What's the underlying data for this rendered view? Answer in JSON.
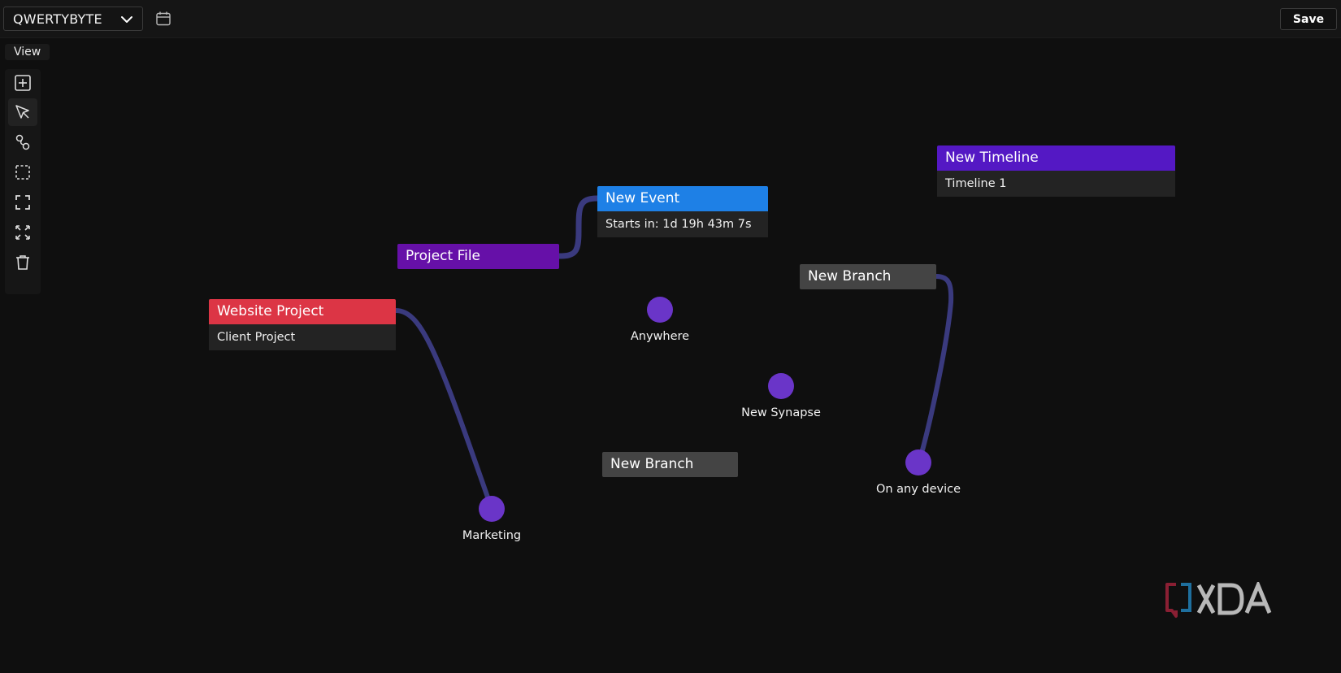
{
  "header": {
    "workspace": "QWERTYBYTE",
    "save_label": "Save"
  },
  "view_tab": "View",
  "toolbar": {
    "tools": [
      "add-icon",
      "select-cursor-icon",
      "link-icon",
      "selection-box-icon",
      "fit-view-icon",
      "expand-icon",
      "trash-icon"
    ]
  },
  "nodes": {
    "website_project": {
      "title": "Website Project",
      "subtitle": "Client Project",
      "color": "#dc3545"
    },
    "project_file": {
      "title": "Project File",
      "color": "#6610a8"
    },
    "new_event": {
      "title": "New Event",
      "subtitle": "Starts in: 1d 19h 43m 7s",
      "color": "#1e80e6"
    },
    "new_timeline": {
      "title": "New Timeline",
      "subtitle": "Timeline 1",
      "color": "#5418c4"
    },
    "new_branch_1": {
      "title": "New Branch",
      "color": "#444444"
    },
    "new_branch_2": {
      "title": "New Branch",
      "color": "#444444"
    }
  },
  "synapses": {
    "anywhere": {
      "label": "Anywhere"
    },
    "new_synapse": {
      "label": "New Synapse"
    },
    "marketing": {
      "label": "Marketing"
    },
    "on_any_device": {
      "label": "On any device"
    }
  },
  "colors": {
    "synapse": "#6a35c8",
    "link": "#3a3a7e",
    "background": "#0f0f0f"
  },
  "watermark": "XDA"
}
